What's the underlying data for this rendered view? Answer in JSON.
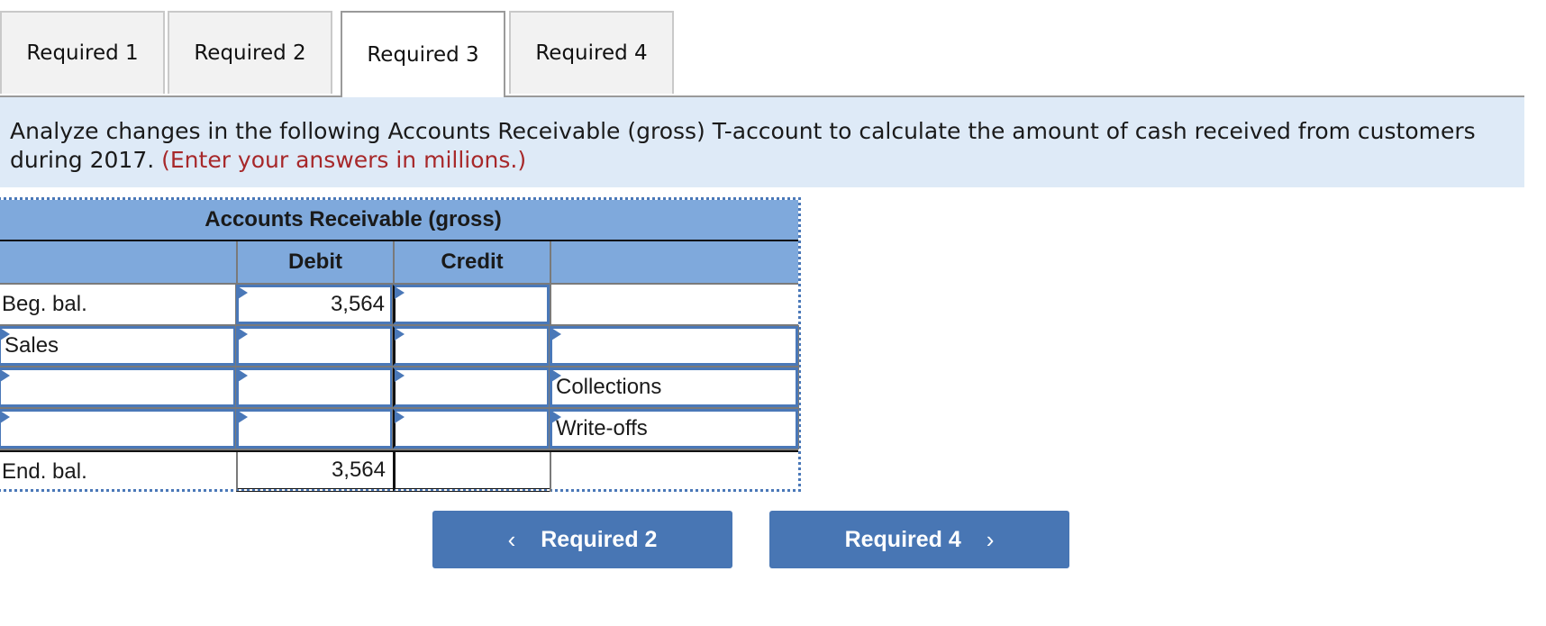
{
  "tabs": [
    {
      "label": "Required 1",
      "active": false
    },
    {
      "label": "Required 2",
      "active": false
    },
    {
      "label": "Required 3",
      "active": true
    },
    {
      "label": "Required 4",
      "active": false
    }
  ],
  "instructions": {
    "text": "Analyze changes in the following Accounts Receivable (gross) T-account to calculate the amount of cash received from customers during 2017.",
    "hint": "(Enter your answers in millions.)"
  },
  "t_account": {
    "title": "Accounts Receivable (gross)",
    "columns": {
      "debit": "Debit",
      "credit": "Credit"
    },
    "rows": [
      {
        "label": "Beg. bal.",
        "debit": "3,564",
        "credit": "",
        "description": ""
      },
      {
        "label": "Sales",
        "debit": "",
        "credit": "",
        "description": ""
      },
      {
        "label": "",
        "debit": "",
        "credit": "",
        "description": "Collections"
      },
      {
        "label": "",
        "debit": "",
        "credit": "",
        "description": "Write-offs"
      },
      {
        "label": "End. bal.",
        "debit": "3,564",
        "credit": "",
        "description": ""
      }
    ]
  },
  "nav": {
    "prev_label": "Required 2",
    "next_label": "Required 4",
    "prev_icon": "chevron-left-icon",
    "next_icon": "chevron-right-icon",
    "accent_color": "#4876b4"
  }
}
